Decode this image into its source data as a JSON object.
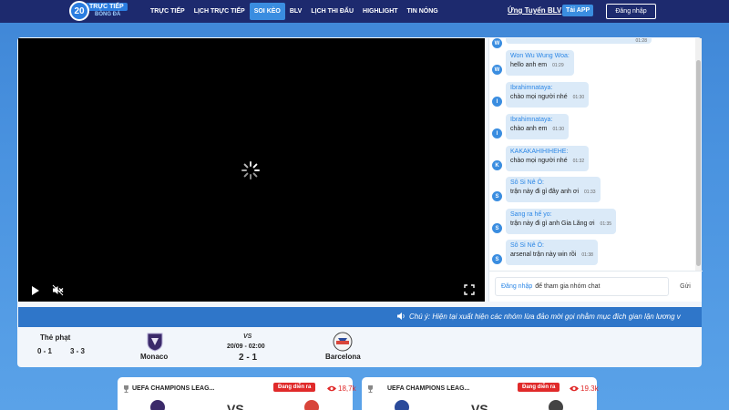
{
  "header": {
    "logo_number": "20",
    "logo_top": "TRỰC TIẾP",
    "logo_bottom": "BÓNG ĐÁ",
    "nav": [
      "TRỰC TIẾP",
      "LỊCH TRỰC TIẾP",
      "SOI KÈO",
      "BLV",
      "LỊCH THI ĐẤU",
      "HIGHLIGHT",
      "TIN NÓNG"
    ],
    "active_nav": "SOI KÈO",
    "ung_tuyen": "Ứng Tuyển BLV",
    "tai_app": "Tải APP",
    "login": "Đăng nhập"
  },
  "chat": {
    "first_time": "01:28",
    "messages": [
      {
        "initial": "W",
        "name": "Won Wu Wung Woa:",
        "text": "hello anh em",
        "time": "01:29"
      },
      {
        "initial": "I",
        "name": "Ibrahimnataya:",
        "text": "chào mọi người nhé",
        "time": "01:30"
      },
      {
        "initial": "I",
        "name": "Ibrahimnataya:",
        "text": "chào anh em",
        "time": "01:30"
      },
      {
        "initial": "K",
        "name": "KAKAKAHIHIHEHE:",
        "text": "chào mọi người nhé",
        "time": "01:32"
      },
      {
        "initial": "S",
        "name": "Sô Si Nê Ô:",
        "text": "trận này đi gỉ đây anh ơi",
        "time": "01:33"
      },
      {
        "initial": "S",
        "name": "Sang ra hế yo:",
        "text": "trận này đi gì anh Gia Lăng ơi",
        "time": "01:35"
      },
      {
        "initial": "S",
        "name": "Sô Si Nê Ô:",
        "text": "arsenal trận này win rồi",
        "time": "01:38"
      }
    ],
    "input_link": "Đăng nhập",
    "input_text": "để tham gia nhóm chat",
    "send": "Gửi"
  },
  "marquee": "Chú ý: Hiện tại xuất hiện các nhóm lừa đảo mời gọi nhằm mục đích gian lận lương v",
  "match": {
    "penalty_label": "Thẻ phạt",
    "penalty_a": "0 - 1",
    "penalty_b": "3 - 3",
    "home": "Monaco",
    "away": "Barcelona",
    "vs": "VS",
    "datetime": "20/09 - 02:00",
    "score": "2 - 1"
  },
  "cards": [
    {
      "league": "UEFA CHAMPIONS LEAG...",
      "live": "Đang diễn ra",
      "views": "18,7k",
      "vs": "VS"
    },
    {
      "league": "UEFA CHAMPIONS LEAG...",
      "live": "Đang diễn ra",
      "views": "19.3k",
      "vs": "VS"
    }
  ]
}
